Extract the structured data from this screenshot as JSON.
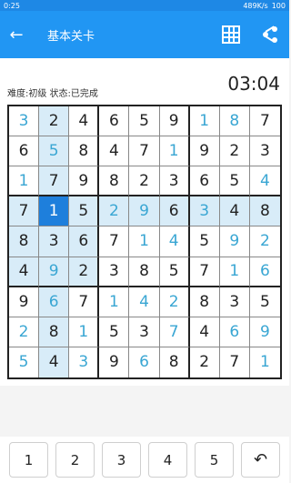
{
  "status": {
    "time": "0:25",
    "speed": "489K/s",
    "battery": "100"
  },
  "appbar": {
    "title": "基本关卡",
    "back_icon": "arrow-left-icon",
    "grid_icon": "grid-icon",
    "share_icon": "share-icon"
  },
  "game": {
    "info": "难度:初级  状态:已完成",
    "timer": "03:04",
    "grid": [
      [
        "3",
        "2",
        "4",
        "6",
        "5",
        "9",
        "1",
        "8",
        "7"
      ],
      [
        "6",
        "5",
        "8",
        "4",
        "7",
        "1",
        "9",
        "2",
        "3"
      ],
      [
        "1",
        "7",
        "9",
        "8",
        "2",
        "3",
        "6",
        "5",
        "4"
      ],
      [
        "7",
        "1",
        "5",
        "2",
        "9",
        "6",
        "3",
        "4",
        "8"
      ],
      [
        "8",
        "3",
        "6",
        "7",
        "1",
        "4",
        "5",
        "9",
        "2"
      ],
      [
        "4",
        "9",
        "2",
        "3",
        "8",
        "5",
        "7",
        "1",
        "6"
      ],
      [
        "9",
        "6",
        "7",
        "1",
        "4",
        "2",
        "8",
        "3",
        "5"
      ],
      [
        "2",
        "8",
        "1",
        "5",
        "3",
        "7",
        "4",
        "6",
        "9"
      ],
      [
        "5",
        "4",
        "3",
        "9",
        "6",
        "8",
        "2",
        "7",
        "1"
      ]
    ]
  },
  "keypad": {
    "keys": [
      "1",
      "2",
      "3",
      "4",
      "5"
    ],
    "undo": "↶"
  }
}
